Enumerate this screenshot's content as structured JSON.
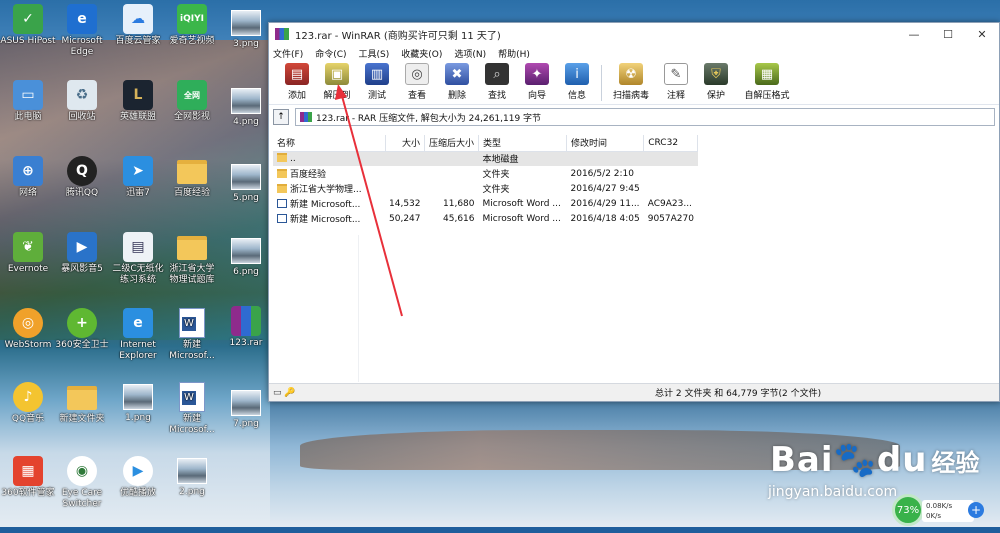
{
  "desktop": {
    "icons": [
      {
        "label": "ASUS HiPost",
        "x": 0
      },
      {
        "label": "Microsoft Edge"
      },
      {
        "label": "百度云管家"
      },
      {
        "label": "爱奇艺视频"
      },
      {
        "label": "3.png"
      },
      {
        "label": "此电脑"
      },
      {
        "label": "回收站"
      },
      {
        "label": "英雄联盟"
      },
      {
        "label": "全网影视"
      },
      {
        "label": "4.png"
      },
      {
        "label": "网络"
      },
      {
        "label": "腾讯QQ"
      },
      {
        "label": "迅雷7"
      },
      {
        "label": "百度经验"
      },
      {
        "label": "5.png"
      },
      {
        "label": "Evernote"
      },
      {
        "label": "暴风影音5"
      },
      {
        "label": "二级C无纸化 练习系统"
      },
      {
        "label": "浙江省大学 物理试题库"
      },
      {
        "label": "6.png"
      },
      {
        "label": "WebStorm"
      },
      {
        "label": "360安全卫士"
      },
      {
        "label": "Internet Explorer"
      },
      {
        "label": "新建 Microsof..."
      },
      {
        "label": "123.rar"
      },
      {
        "label": "QQ音乐"
      },
      {
        "label": "新建文件夹"
      },
      {
        "label": "1.png"
      },
      {
        "label": "新建 Microsof..."
      },
      {
        "label": "7.png"
      },
      {
        "label": "360软件管家"
      },
      {
        "label": "Eye Care Switcher"
      },
      {
        "label": "优酷播放"
      },
      {
        "label": "2.png"
      }
    ]
  },
  "window": {
    "title": "123.rar - WinRAR (商购买许可只剩 11 天了)",
    "controls": {
      "minimize": "—",
      "maximize": "☐",
      "close": "✕"
    },
    "menu": [
      "文件(F)",
      "命令(C)",
      "工具(S)",
      "收藏夹(O)",
      "选项(N)",
      "帮助(H)"
    ],
    "toolbar": [
      {
        "label": "添加",
        "icon": "add-archive-icon",
        "color": "#b4322e"
      },
      {
        "label": "解压到",
        "icon": "extract-to-icon",
        "color": "#7a7a2e"
      },
      {
        "label": "测试",
        "icon": "test-icon",
        "color": "#2b4fa3"
      },
      {
        "label": "查看",
        "icon": "view-icon",
        "color": "#555555"
      },
      {
        "label": "删除",
        "icon": "delete-icon",
        "color": "#3a5fb8"
      },
      {
        "label": "查找",
        "icon": "find-icon",
        "color": "#333333"
      },
      {
        "label": "向导",
        "icon": "wizard-icon",
        "color": "#8e2b8c"
      },
      {
        "label": "信息",
        "icon": "info-icon",
        "color": "#2b6fb8"
      },
      {
        "label": "扫描病毒",
        "icon": "scan-virus-icon",
        "color": "#c89a2a"
      },
      {
        "label": "注释",
        "icon": "comment-icon",
        "color": "#666666"
      },
      {
        "label": "保护",
        "icon": "protect-icon",
        "color": "#4a5a4a"
      },
      {
        "label": "自解压格式",
        "icon": "sfx-icon",
        "color": "#6a8a2a"
      }
    ],
    "address": {
      "up": "↑",
      "path": "123.rar - RAR 压缩文件, 解包大小为 24,261,119 字节"
    },
    "columns": [
      "名称",
      "大小",
      "压缩后大小",
      "类型",
      "修改时间",
      "CRC32"
    ],
    "rows": [
      {
        "name": "..",
        "size": "",
        "packed": "",
        "type": "本地磁盘",
        "modified": "",
        "crc": "",
        "kind": "updir"
      },
      {
        "name": "百度经验",
        "size": "",
        "packed": "",
        "type": "文件夹",
        "modified": "2016/5/2 2:10",
        "crc": "",
        "kind": "folder"
      },
      {
        "name": "浙江省大学物理...",
        "size": "",
        "packed": "",
        "type": "文件夹",
        "modified": "2016/4/27 9:45",
        "crc": "",
        "kind": "folder"
      },
      {
        "name": "新建 Microsoft...",
        "size": "14,532",
        "packed": "11,680",
        "type": "Microsoft Word ...",
        "modified": "2016/4/29 11...",
        "crc": "AC9A23...",
        "kind": "doc"
      },
      {
        "name": "新建 Microsoft...",
        "size": "50,247",
        "packed": "45,616",
        "type": "Microsoft Word ...",
        "modified": "2016/4/18 4:05",
        "crc": "9057A270",
        "kind": "doc"
      }
    ],
    "status": {
      "left_icons": "▭ 🔑",
      "right": "总计 2 文件夹 和 64,779 字节(2 个文件)"
    }
  },
  "watermark": {
    "brand": "Bai",
    "brand_paw": "🐾",
    "brand_du": "du",
    "brand_cn": "经验",
    "url": "jingyan.baidu.com"
  },
  "speed_widget": {
    "percent": "73%",
    "up": "0.08K/s",
    "down": "0K/s",
    "plus": "+"
  }
}
